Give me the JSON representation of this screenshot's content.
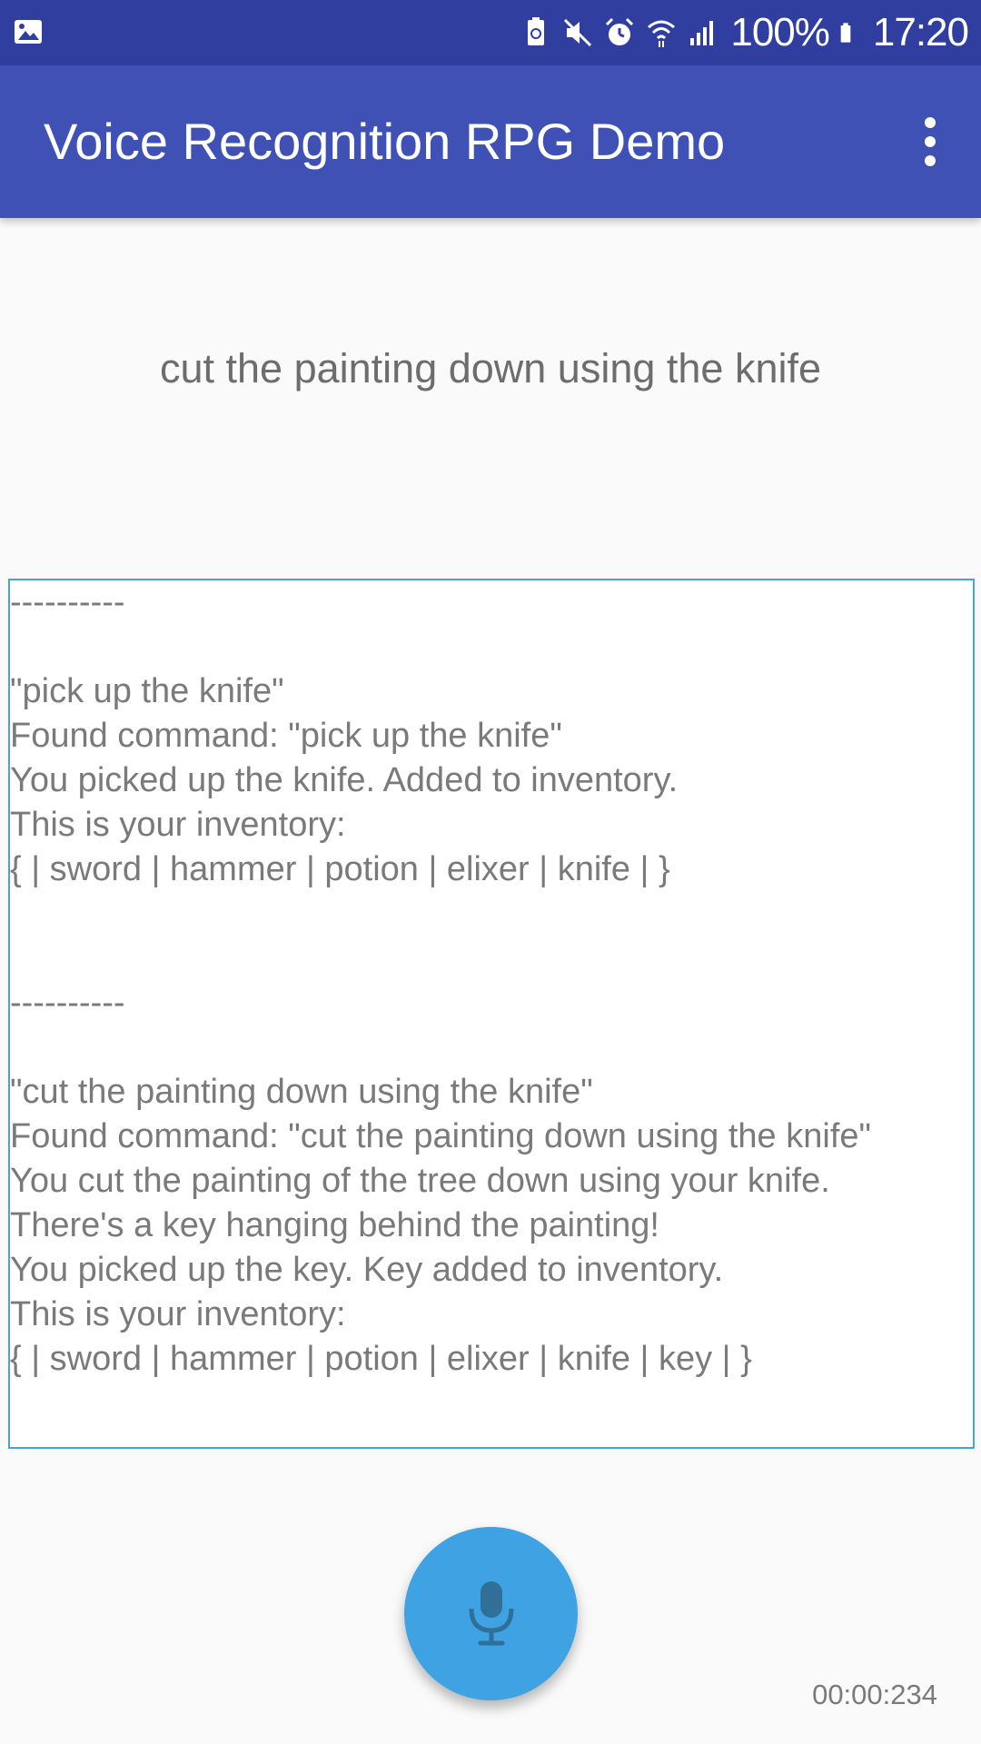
{
  "status_bar": {
    "battery_percent": "100%",
    "time": "17:20",
    "icons": [
      "image-icon",
      "battery-saver-icon",
      "mute-icon",
      "alarm-icon",
      "wifi-icon",
      "signal-icon",
      "battery-icon"
    ]
  },
  "app_bar": {
    "title": "Voice Recognition RPG Demo",
    "menu_icon": "more-vert-icon"
  },
  "recognized_text": "cut the painting down using the knife",
  "log": {
    "lines": [
      "----------",
      "",
      "\"pick up the knife\"",
      "Found command: \"pick up the knife\"",
      "You picked up the knife. Added to inventory.",
      "This is your inventory:",
      "{ | sword | hammer | potion | elixer | knife | }",
      "",
      "",
      "----------",
      "",
      "\"cut the painting down using the knife\"",
      "Found command: \"cut the painting down using the knife\"",
      "You cut the painting of the tree down using your knife.",
      "There's a key hanging behind the painting!",
      "You picked up the key. Key added to inventory.",
      "This is your inventory:",
      "{ | sword | hammer | potion | elixer | knife | key | }"
    ]
  },
  "mic_button": {
    "icon": "microphone-icon"
  },
  "timer": "00:00:234",
  "colors": {
    "status_bar": "#303f9f",
    "app_bar": "#3f51b5",
    "fab": "#3ea2e3",
    "log_border": "#4aa3d8"
  }
}
